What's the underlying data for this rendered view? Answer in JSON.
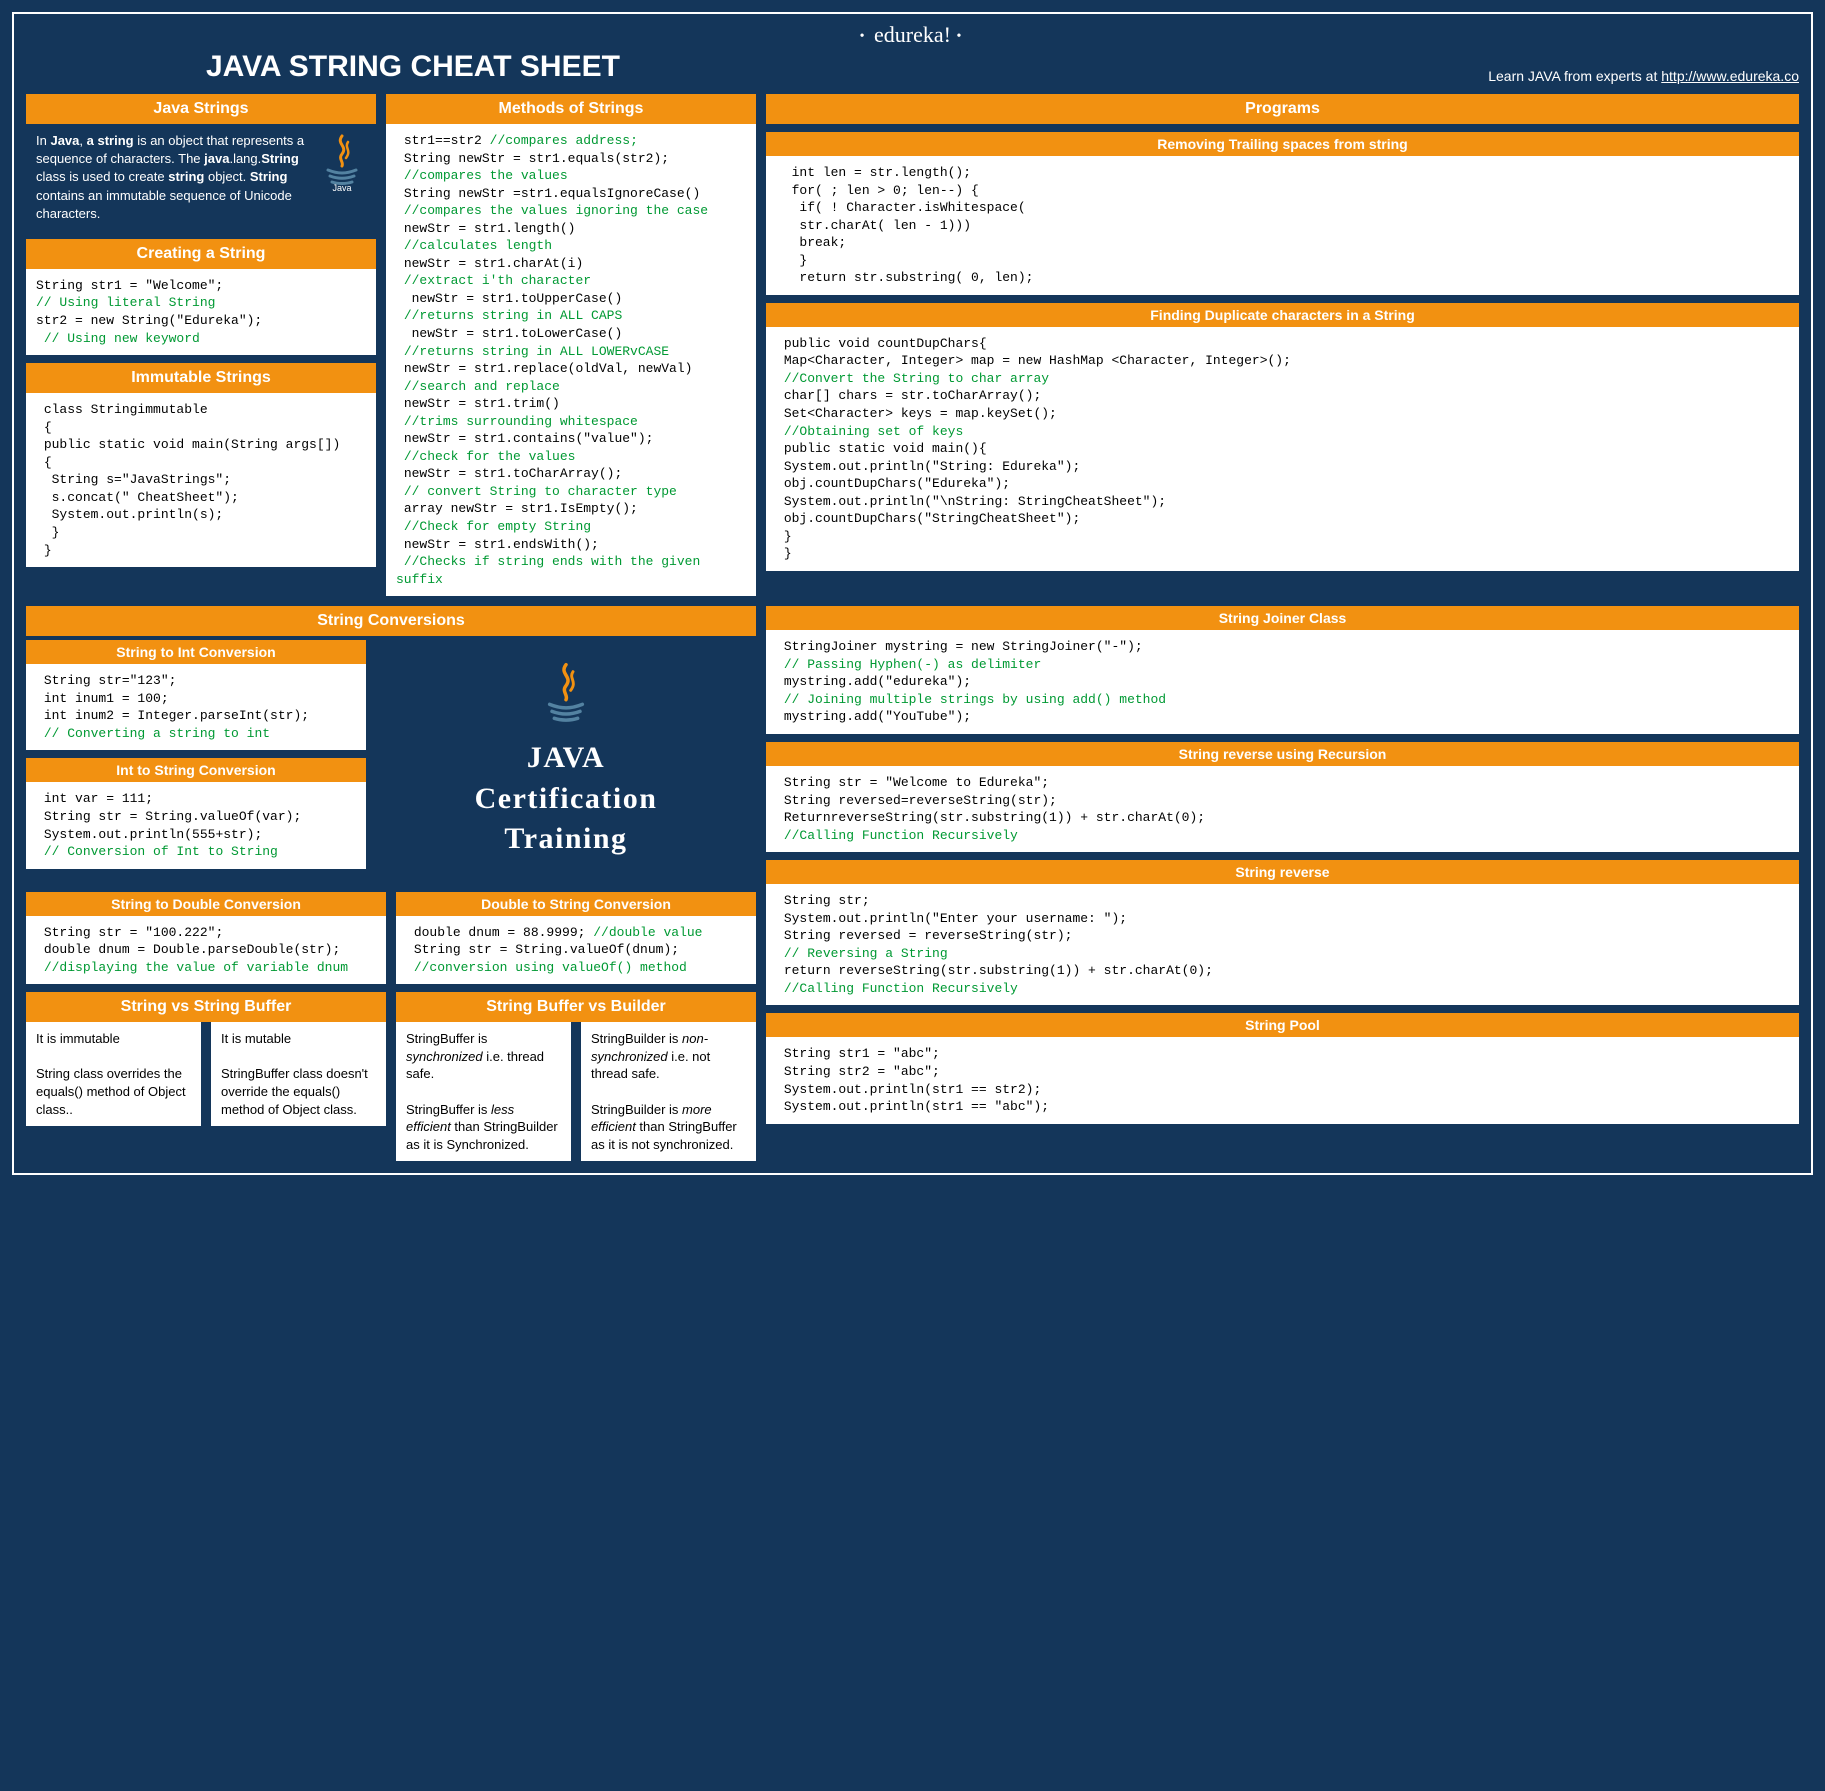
{
  "brand": "edureka!",
  "maintitle": "JAVA STRING CHEAT  SHEET",
  "learn_prefix": "Learn JAVA from experts at ",
  "learn_url": "http://www.edureka.co",
  "promo": "JAVA\nCertification\nTraining",
  "headers": {
    "javaStrings": "Java Strings",
    "creating": "Creating a String",
    "immutable": "Immutable Strings",
    "methods": "Methods of Strings",
    "programs": "Programs",
    "conversions": "String Conversions",
    "svsb": "String vs String Buffer",
    "bvb": "String Buffer vs Builder"
  },
  "sub": {
    "removeTrail": "Removing Trailing spaces from string",
    "findDup": "Finding Duplicate characters in a String",
    "s2i": "String to Int Conversion",
    "i2s": "Int to String Conversion",
    "s2d": "String to Double Conversion",
    "d2s": "Double to String Conversion",
    "joiner": "String Joiner Class",
    "revRec": "String reverse using Recursion",
    "rev": "String reverse",
    "pool": "String Pool"
  },
  "desc": {
    "javaStrings_html": "In <b>Java</b>, <b>a string</b> is an object that represents a sequence of characters. The <b>java</b>.lang.<b>String</b> class is used to create <b>string</b> object. <b>String</b> contains an immutable sequence of Unicode characters."
  },
  "code": {
    "creating": [
      {
        "t": "String str1 = \"Welcome\";"
      },
      {
        "c": "// Using literal String"
      },
      {
        "t": "str2 = new String(\"Edureka\");"
      },
      {
        "c": " // Using new keyword"
      }
    ],
    "immutable": [
      {
        "t": " class Stringimmutable"
      },
      {
        "t": " {"
      },
      {
        "t": " public static void main(String args[])"
      },
      {
        "t": " {"
      },
      {
        "t": "  String s=\"JavaStrings\";"
      },
      {
        "t": "  s.concat(\" CheatSheet\");"
      },
      {
        "t": "  System.out.println(s);"
      },
      {
        "t": "  }"
      },
      {
        "t": " }"
      }
    ],
    "methods": [
      {
        "t": " str1==str2 ",
        "c": "//compares address;"
      },
      {
        "t": " String newStr = str1.equals(str2);"
      },
      {
        "c": " //compares the values"
      },
      {
        "t": " String newStr =str1.equalsIgnoreCase()"
      },
      {
        "c": " //compares the values ignoring the case"
      },
      {
        "t": " newStr = str1.length()"
      },
      {
        "c": " //calculates length"
      },
      {
        "t": " newStr = str1.charAt(i)"
      },
      {
        "c": " //extract i'th character"
      },
      {
        "t": "  newStr = str1.toUpperCase()"
      },
      {
        "c": " //returns string in ALL CAPS"
      },
      {
        "t": "  newStr = str1.toLowerCase()"
      },
      {
        "c": " //returns string in ALL LOWERvCASE"
      },
      {
        "t": " newStr = str1.replace(oldVal, newVal)"
      },
      {
        "c": " //search and replace"
      },
      {
        "t": " newStr = str1.trim()"
      },
      {
        "c": " //trims surrounding whitespace"
      },
      {
        "t": " newStr = str1.contains(\"value\");"
      },
      {
        "c": " //check for the values"
      },
      {
        "t": " newStr = str1.toCharArray();"
      },
      {
        "c": " // convert String to character type"
      },
      {
        "t": " array newStr = str1.IsEmpty();"
      },
      {
        "c": " //Check for empty String"
      },
      {
        "t": " newStr = str1.endsWith();"
      },
      {
        "c": " //Checks if string ends with the given suffix"
      }
    ],
    "removeTrail": [
      {
        "t": "  int len = str.length();"
      },
      {
        "t": "  for( ; len > 0; len--) {"
      },
      {
        "t": "   if( ! Character.isWhitespace("
      },
      {
        "t": "   str.charAt( len - 1)))"
      },
      {
        "t": "   break;"
      },
      {
        "t": "   }"
      },
      {
        "t": "   return str.substring( 0, len);"
      }
    ],
    "findDup": [
      {
        "t": " public void countDupChars{"
      },
      {
        "t": " Map<Character, Integer> map = new HashMap <Character, Integer>();"
      },
      {
        "c": " //Convert the String to char array"
      },
      {
        "t": " char[] chars = str.toCharArray();"
      },
      {
        "t": " Set<Character> keys = map.keySet();"
      },
      {
        "c": " //Obtaining set of keys"
      },
      {
        "t": " public static void main(){"
      },
      {
        "t": " System.out.println(\"String: Edureka\");"
      },
      {
        "t": " obj.countDupChars(\"Edureka\");"
      },
      {
        "t": " System.out.println(\"\\nString: StringCheatSheet\");"
      },
      {
        "t": " obj.countDupChars(\"StringCheatSheet\");"
      },
      {
        "t": " }"
      },
      {
        "t": " }"
      }
    ],
    "s2i": [
      {
        "t": " String str=\"123\";"
      },
      {
        "t": " int inum1 = 100;"
      },
      {
        "t": " int inum2 = Integer.parseInt(str);"
      },
      {
        "c": " // Converting a string to int"
      }
    ],
    "i2s": [
      {
        "t": " int var = 111;"
      },
      {
        "t": " String str = String.valueOf(var);"
      },
      {
        "t": " System.out.println(555+str);"
      },
      {
        "c": " // Conversion of Int to String"
      }
    ],
    "s2d": [
      {
        "t": " String str = \"100.222\";"
      },
      {
        "t": " double dnum = Double.parseDouble(str);"
      },
      {
        "c": " //displaying the value of variable dnum"
      }
    ],
    "d2s": [
      {
        "t": " double dnum = 88.9999; ",
        "c": "//double value"
      },
      {
        "t": " String str = String.valueOf(dnum);"
      },
      {
        "c": " //conversion using valueOf() method"
      }
    ],
    "joiner": [
      {
        "t": " StringJoiner mystring = new StringJoiner(\"-\");"
      },
      {
        "c": " // Passing Hyphen(-) as delimiter"
      },
      {
        "t": " mystring.add(\"edureka\");"
      },
      {
        "c": " // Joining multiple strings by using add() method"
      },
      {
        "t": " mystring.add(\"YouTube\");"
      }
    ],
    "revRec": [
      {
        "t": " String str = \"Welcome to Edureka\";"
      },
      {
        "t": " String reversed=reverseString(str);"
      },
      {
        "t": " ReturnreverseString(str.substring(1)) + str.charAt(0);"
      },
      {
        "c": " //Calling Function Recursively"
      }
    ],
    "rev": [
      {
        "t": " String str;"
      },
      {
        "t": " System.out.println(\"Enter your username: \");"
      },
      {
        "t": " String reversed = reverseString(str);"
      },
      {
        "c": " // Reversing a String"
      },
      {
        "t": " return reverseString(str.substring(1)) + str.charAt(0);"
      },
      {
        "c": " //Calling Function Recursively"
      }
    ],
    "pool": [
      {
        "t": " String str1 = \"abc\";"
      },
      {
        "t": " String str2 = \"abc\";"
      },
      {
        "t": " System.out.println(str1 == str2);"
      },
      {
        "t": " System.out.println(str1 == \"abc\");"
      }
    ]
  },
  "compare": {
    "svsb_left": "It is immutable\n\nString class overrides the equals() method of Object class..",
    "svsb_right": "It is mutable\n\nStringBuffer class doesn't override the equals() method of Object class.",
    "bvb_left_html": "StringBuffer is <i>synchronized</i> i.e. thread safe.<br><br>StringBuffer is <i>less efficient</i> than StringBuilder as it is Synchronized.",
    "bvb_right_html": "StringBuilder is <i>non-synchronized</i> i.e. not thread safe.<br><br>StringBuilder is <i>more efficient</i> than StringBuffer as it is not synchronized."
  }
}
